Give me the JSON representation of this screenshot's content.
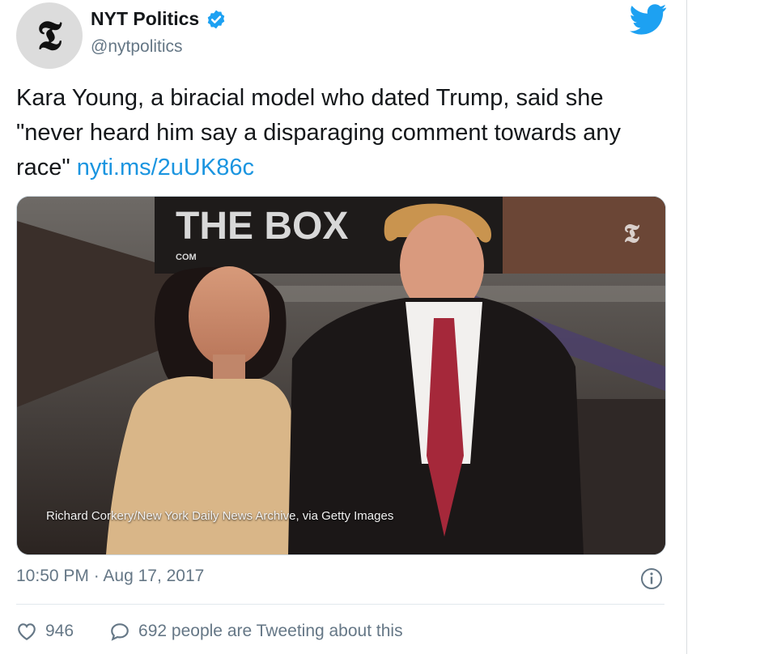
{
  "account": {
    "name": "NYT Politics",
    "handle": "@nytpolitics",
    "avatar_glyph": "𝕿",
    "verified_icon": "verified-badge-icon",
    "verified_color": "#1da1f2"
  },
  "tweet": {
    "text": "Kara Young, a biracial model who dated Trump, said she \"never heard him say a disparaging comment towards any race\" ",
    "link_text": "nyti.ms/2uUK86c",
    "link_color": "#1b95e0"
  },
  "media": {
    "credit": "Richard Corkery/New York Daily News Archive, via Getty Images",
    "poster_text": "THE BOX",
    "poster_subtext": "COM",
    "watermark_glyph": "𝕿"
  },
  "meta": {
    "timestamp": "10:50 PM · Aug 17, 2017",
    "info_icon": "info-icon"
  },
  "actions": {
    "like_count": "946",
    "conversation_text": "692 people are Tweeting about this"
  },
  "colors": {
    "brand_blue": "#1da1f2",
    "secondary_text": "#657786",
    "primary_text": "#14171a"
  }
}
